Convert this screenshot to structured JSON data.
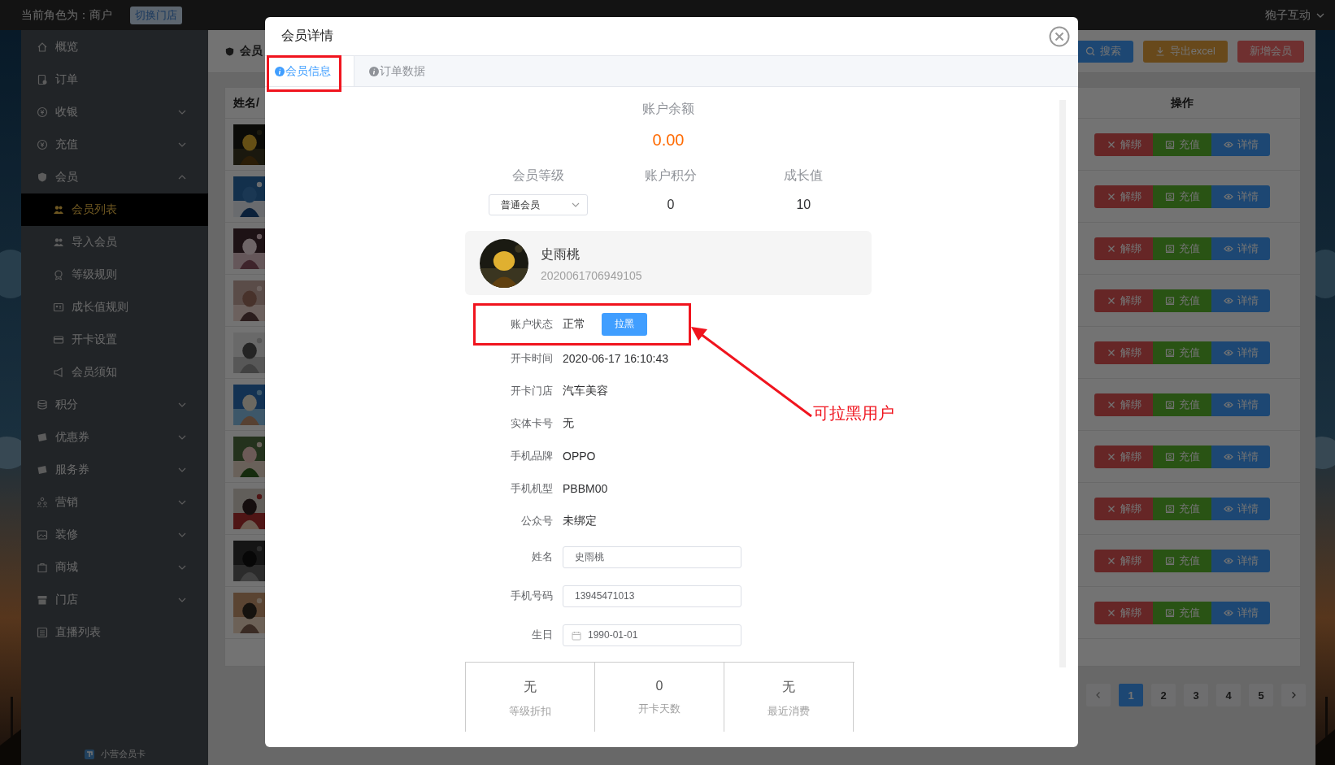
{
  "header": {
    "role": "当前角色为：商户",
    "switch_store": "切换门店",
    "account": "狍子互动"
  },
  "sidebar": {
    "items": [
      {
        "label": "概览"
      },
      {
        "label": "订单"
      },
      {
        "label": "收银",
        "expanded": false
      },
      {
        "label": "充值",
        "expanded": false
      },
      {
        "label": "会员",
        "expanded": true,
        "children": [
          {
            "label": "会员列表",
            "selected": true
          },
          {
            "label": "导入会员",
            "selected": false
          },
          {
            "label": "等级规则",
            "selected": false
          },
          {
            "label": "成长值规则",
            "selected": false
          },
          {
            "label": "开卡设置",
            "selected": false
          },
          {
            "label": "会员须知",
            "selected": false
          }
        ]
      },
      {
        "label": "积分",
        "expanded": false
      },
      {
        "label": "优惠券",
        "expanded": false
      },
      {
        "label": "服务券",
        "expanded": false
      },
      {
        "label": "营销",
        "expanded": false
      },
      {
        "label": "装修",
        "expanded": false
      },
      {
        "label": "商城",
        "expanded": false
      },
      {
        "label": "门店",
        "expanded": false
      },
      {
        "label": "直播列表"
      }
    ],
    "footer": "小营会员卡"
  },
  "main": {
    "breadcrumb": "会员",
    "toolbar": [
      {
        "label": "搜索",
        "kind": "search"
      },
      {
        "label": "导出excel",
        "kind": "export"
      },
      {
        "label": "新增会员",
        "kind": "add"
      }
    ],
    "table": {
      "columns": [
        "姓名/",
        "操作"
      ],
      "rows": [
        {
          "actions": [
            {
              "label": "解绑",
              "kind": "unbind"
            },
            {
              "label": "充值",
              "kind": "recharge"
            },
            {
              "label": "详情",
              "kind": "detail"
            }
          ]
        },
        {
          "actions": [
            {
              "label": "解绑",
              "kind": "unbind"
            },
            {
              "label": "充值",
              "kind": "recharge"
            },
            {
              "label": "详情",
              "kind": "detail"
            }
          ]
        },
        {
          "actions": [
            {
              "label": "解绑",
              "kind": "unbind"
            },
            {
              "label": "充值",
              "kind": "recharge"
            },
            {
              "label": "详情",
              "kind": "detail"
            }
          ]
        },
        {
          "actions": [
            {
              "label": "解绑",
              "kind": "unbind"
            },
            {
              "label": "充值",
              "kind": "recharge"
            },
            {
              "label": "详情",
              "kind": "detail"
            }
          ]
        },
        {
          "actions": [
            {
              "label": "解绑",
              "kind": "unbind"
            },
            {
              "label": "充值",
              "kind": "recharge"
            },
            {
              "label": "详情",
              "kind": "detail"
            }
          ]
        },
        {
          "actions": [
            {
              "label": "解绑",
              "kind": "unbind"
            },
            {
              "label": "充值",
              "kind": "recharge"
            },
            {
              "label": "详情",
              "kind": "detail"
            }
          ]
        },
        {
          "actions": [
            {
              "label": "解绑",
              "kind": "unbind"
            },
            {
              "label": "充值",
              "kind": "recharge"
            },
            {
              "label": "详情",
              "kind": "detail"
            }
          ]
        },
        {
          "actions": [
            {
              "label": "解绑",
              "kind": "unbind"
            },
            {
              "label": "充值",
              "kind": "recharge"
            },
            {
              "label": "详情",
              "kind": "detail"
            }
          ]
        },
        {
          "actions": [
            {
              "label": "解绑",
              "kind": "unbind"
            },
            {
              "label": "充值",
              "kind": "recharge"
            },
            {
              "label": "详情",
              "kind": "detail"
            }
          ]
        },
        {
          "actions": [
            {
              "label": "解绑",
              "kind": "unbind"
            },
            {
              "label": "充值",
              "kind": "recharge"
            },
            {
              "label": "详情",
              "kind": "detail"
            }
          ]
        }
      ]
    },
    "pagination": {
      "pages": [
        {
          "label": "1",
          "selected": true
        },
        {
          "label": "2",
          "selected": false
        },
        {
          "label": "3",
          "selected": false
        },
        {
          "label": "4",
          "selected": false
        },
        {
          "label": "5",
          "selected": false
        }
      ]
    }
  },
  "dialog": {
    "title": "会员详情",
    "tabs": [
      {
        "label": "会员信息",
        "selected": true
      },
      {
        "label": "订单数据",
        "selected": false
      }
    ],
    "balance": {
      "label": "账户余额",
      "value": "0.00"
    },
    "stats": [
      {
        "label": "会员等级",
        "value": "普通会员",
        "kind": "select"
      },
      {
        "label": "账户积分",
        "value": "0",
        "kind": "text"
      },
      {
        "label": "成长值",
        "value": "10",
        "kind": "text"
      }
    ],
    "profile": {
      "name": "史雨桃",
      "member_no": "2020061706949105"
    },
    "status": {
      "label": "账户状态",
      "value": "正常",
      "action": "拉黑"
    },
    "details": [
      {
        "label": "开卡时间",
        "value": "2020-06-17 16:10:43"
      },
      {
        "label": "开卡门店",
        "value": "汽车美容"
      },
      {
        "label": "实体卡号",
        "value": "无"
      },
      {
        "label": "手机品牌",
        "value": "OPPO"
      },
      {
        "label": "手机机型",
        "value": "PBBM00"
      },
      {
        "label": "公众号",
        "value": "未绑定"
      }
    ],
    "fields": [
      {
        "label": "姓名",
        "value": "史雨桃",
        "kind": "text"
      },
      {
        "label": "手机号码",
        "value": "13945471013",
        "kind": "text"
      },
      {
        "label": "生日",
        "value": "1990-01-01",
        "kind": "date"
      }
    ],
    "summary": [
      {
        "value": "无",
        "label": "等级折扣"
      },
      {
        "value": "0",
        "label": "开卡天数"
      },
      {
        "value": "无",
        "label": "最近消费"
      }
    ],
    "annotation": {
      "text": "可拉黑用户"
    }
  }
}
